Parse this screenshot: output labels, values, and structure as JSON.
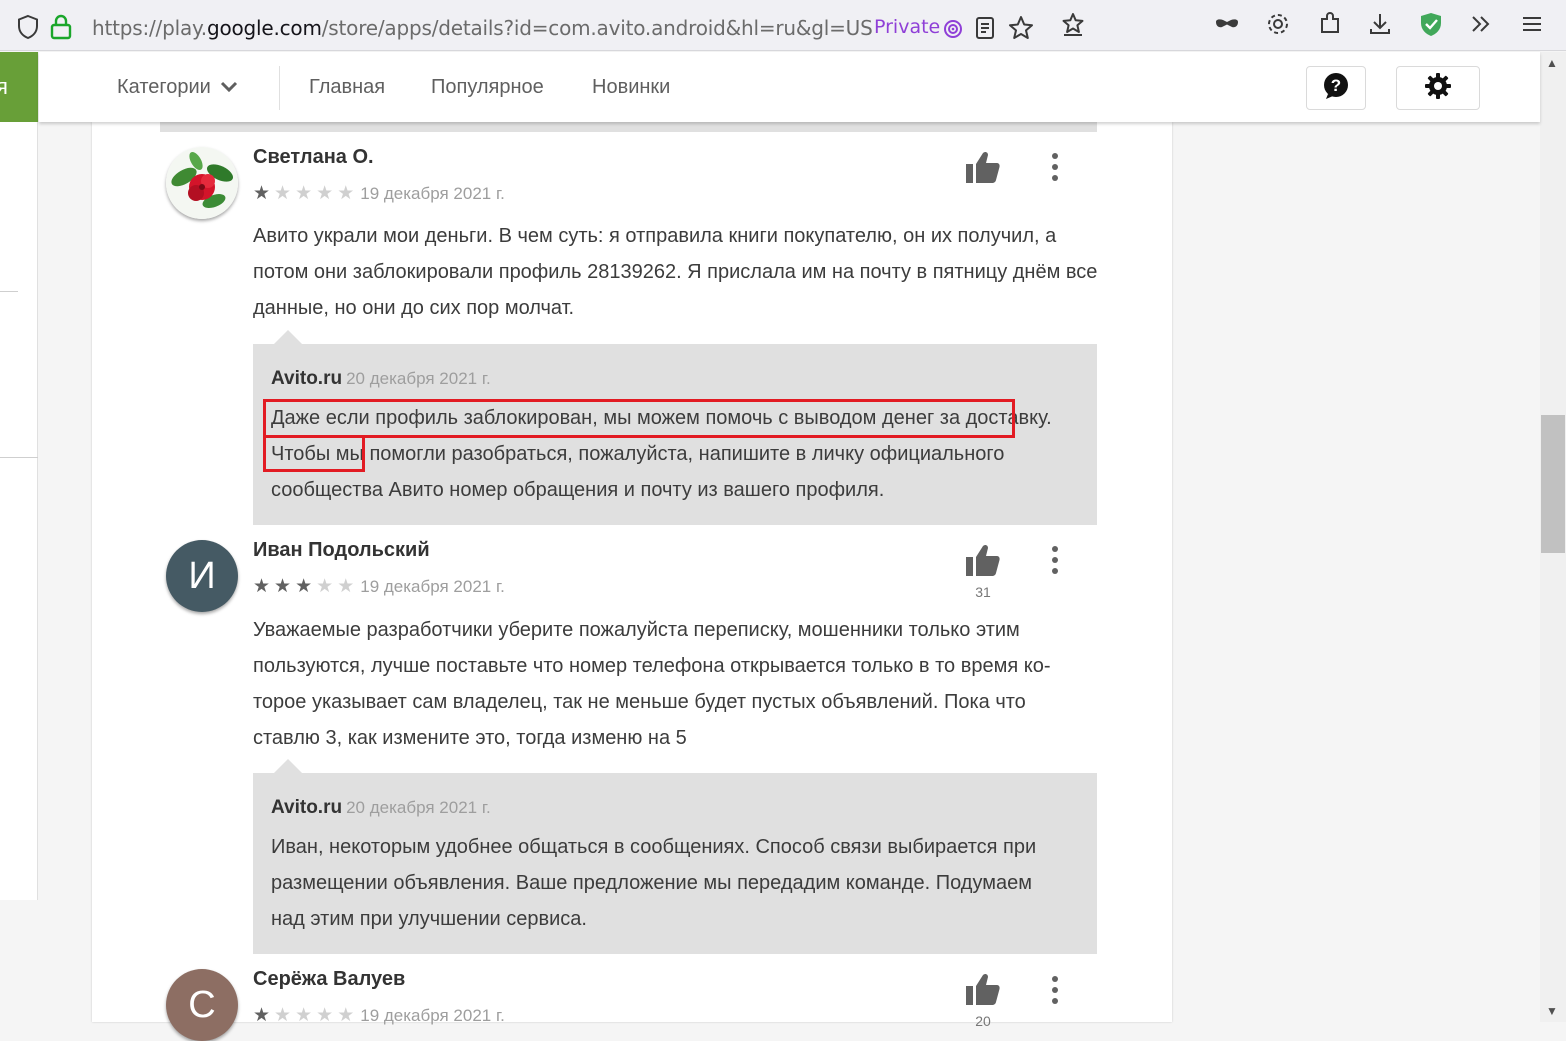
{
  "browser": {
    "url_prefix": "https://play.",
    "url_domain": "google.com",
    "url_rest": "/store/apps/details?id=com.avito.android&hl=ru&gl=US",
    "private_label": "Private"
  },
  "appbar": {
    "green_tab_text": "я",
    "categories_label": "Категории",
    "nav": [
      "Главная",
      "Популярное",
      "Новинки"
    ]
  },
  "reviews": [
    {
      "author": "Светлана О.",
      "rating": 1,
      "date": "19 декабря 2021 г.",
      "helpful_count": "",
      "text": "Авито украли мои деньги. В чем суть: я отправила книги покупателю, он их получил, а потом они заблокировали профиль 28139262. Я прислала им на почту в пятницу днём все данные, но они до сих пор молчат.",
      "reply": {
        "author": "Avito.ru",
        "date": "20 декабря 2021 г.",
        "text": "Даже если профиль заблокирован, мы можем помочь с выводом денег за доставку. Чтобы мы помогли разобраться, пожалуйста, напишите в личку официального сообщества Авито номер обращения и почту из вашего профиля."
      }
    },
    {
      "author": "Иван Подольский",
      "avatar_letter": "И",
      "rating": 3,
      "date": "19 декабря 2021 г.",
      "helpful_count": "31",
      "text": "Уважаемые разработчики уберите пожалуйста переписку, мошенники только этим пользуются, лучше поставьте что номер телефона открывается только в то время ко-торое указывает сам владелец, так не меньше будет пустых объявлений. Пока что ставлю 3, как измените это, тогда изменю на 5",
      "reply": {
        "author": "Avito.ru",
        "date": "20 декабря 2021 г.",
        "text": "Иван, некоторым удобнее общаться в сообщениях. Способ связи выбирается при размещении объявления. Ваше предложение мы передадим команде. Подумаем над этим при улучшении сервиса."
      }
    },
    {
      "author": "Серёжа Валуев",
      "avatar_letter": "С",
      "rating": 1,
      "date": "19 декабря 2021 г.",
      "helpful_count": "20"
    }
  ],
  "colors": {
    "green": "#689f38",
    "highlight": "#e21b23",
    "private": "#8f3fd7",
    "reply_bg": "#e0e0e0"
  }
}
